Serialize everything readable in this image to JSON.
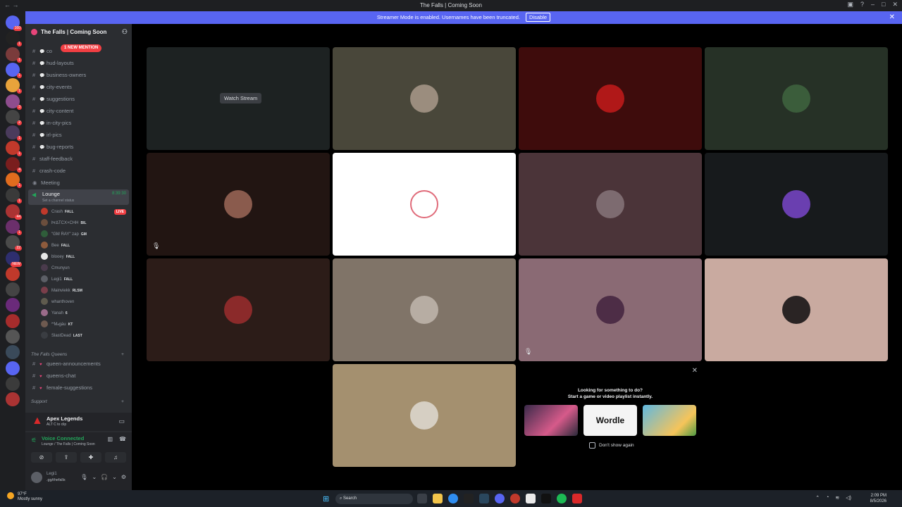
{
  "window": {
    "title": "The Falls | Coming Soon"
  },
  "banner": {
    "text": "Streamer Mode is enabled. Usernames have been truncated.",
    "disable_label": "Disable"
  },
  "server_rail": {
    "badges": [
      "160",
      "1",
      "1",
      "1",
      "1",
      "3",
      "2",
      "1",
      "1",
      "4",
      "1",
      "1",
      "44",
      "1",
      "22",
      "NEW"
    ]
  },
  "guild": {
    "name": "The Falls | Coming Soon",
    "mention_label": "1 NEW MENTION"
  },
  "channels": [
    {
      "name": "co",
      "thread": true
    },
    {
      "name": "hud-layouts",
      "thread": true
    },
    {
      "name": "business-owners",
      "thread": true
    },
    {
      "name": "city-events",
      "thread": true
    },
    {
      "name": "suggestions",
      "thread": true
    },
    {
      "name": "city-content",
      "thread": true
    },
    {
      "name": "in-city-pics",
      "thread": true
    },
    {
      "name": "irl-pics",
      "thread": true
    },
    {
      "name": "bug-reports",
      "thread": true
    },
    {
      "name": "staff-feedback",
      "thread": false
    },
    {
      "name": "crash-code",
      "thread": false
    }
  ],
  "meeting_channel": "Meeting",
  "voice_channel": {
    "name": "Lounge",
    "status": "Set a channel status",
    "timer": "8:39:30"
  },
  "voice_users": [
    {
      "name": "Crash",
      "tag": "FALL",
      "color": "#c0392b",
      "live": true
    },
    {
      "name": "ϷrΔTCX×CHH",
      "tag": "BIL",
      "color": "#6b4e3d",
      "live": false
    },
    {
      "name": "\"GM RAY\" zap",
      "tag": "GM",
      "color": "#2f5d3a",
      "live": false
    },
    {
      "name": "Bee",
      "tag": "FALL",
      "color": "#8e5b3c",
      "live": false
    },
    {
      "name": "blooey",
      "tag": "FALL",
      "color": "#e6e6e6",
      "live": false
    },
    {
      "name": "Cmunyun",
      "tag": "",
      "color": "#4a3b4c",
      "live": false
    },
    {
      "name": "Legi1",
      "tag": "FALL",
      "color": "#5c5f66",
      "live": false
    },
    {
      "name": "Mainviekk",
      "tag": "RLSM",
      "color": "#7a3e4a",
      "live": false
    },
    {
      "name": "whanthoven",
      "tag": "",
      "color": "#5f5b4e",
      "live": false
    },
    {
      "name": "Yanah",
      "tag": "6",
      "color": "#9a6b8a",
      "live": false
    },
    {
      "name": "ꟸM𝓲gáu",
      "tag": "KT",
      "color": "#6e5a50",
      "live": false
    },
    {
      "name": "SlastDead",
      "tag": "LAST",
      "color": "#3a3d42",
      "live": false
    }
  ],
  "live_label": "LIVE",
  "categories": [
    {
      "name": "The Falls Queens",
      "channels": [
        "queen-announcements",
        "queens-chat",
        "female-suggestions"
      ]
    },
    {
      "name": "Support",
      "channels": []
    }
  ],
  "activity": {
    "game": "Apex Legends",
    "hint": "ALT  C  to clip"
  },
  "voice_connection": {
    "title": "Voice Connected",
    "location": "Lounge / The Falls | Coming Soon"
  },
  "user": {
    "name": "Legi1",
    "status": ".gg/thefalls"
  },
  "stage": {
    "watch_label": "Watch Stream",
    "tiles": [
      {
        "bg": "#1d2222",
        "avatar": null
      },
      {
        "bg": "#49473a",
        "avatar": "#9b8d7e"
      },
      {
        "bg": "#3e0c0c",
        "avatar": "#b01818"
      },
      {
        "bg": "#263126",
        "avatar": "#3b5d3b"
      },
      {
        "bg": "#221512",
        "avatar": "#8a5b4d"
      },
      {
        "bg": "#ffffff",
        "avatar": "#ffffff"
      },
      {
        "bg": "#4b3439",
        "avatar": "#7d6b70"
      },
      {
        "bg": "#171a1c",
        "avatar": "#6a3fb0"
      },
      {
        "bg": "#2c1c18",
        "avatar": "#8b2a2a"
      },
      {
        "bg": "#807468",
        "avatar": "#b7ada3"
      },
      {
        "bg": "#8a6a74",
        "avatar": "#4d2d46"
      },
      {
        "bg": "#c9aaa0",
        "avatar": "#2a2424"
      },
      {
        "bg": "#a4906f",
        "avatar": "#d6cfc3"
      }
    ]
  },
  "activity_popup": {
    "heading": "Looking for something to do?",
    "subheading": "Start a game or video playlist instantly.",
    "cards": [
      "",
      "Wordle",
      ""
    ],
    "dont_show": "Don't show again"
  },
  "taskbar": {
    "temp": "97°F",
    "weather": "Mostly sunny",
    "search_placeholder": "Search",
    "time": "2:09 PM",
    "date": "8/5/2026"
  }
}
